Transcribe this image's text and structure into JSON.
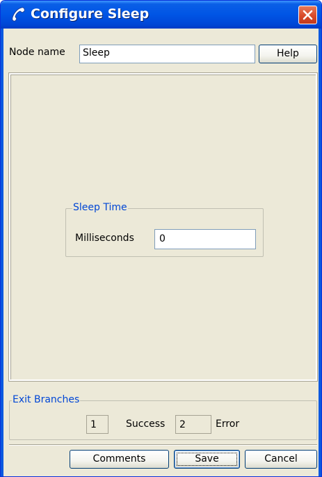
{
  "window": {
    "title": "Configure Sleep",
    "icons": {
      "app": "phone-handset-icon",
      "close": "close-icon"
    }
  },
  "header": {
    "node_name_label": "Node name",
    "node_name_value": "Sleep",
    "help_label": "Help"
  },
  "sleep_time": {
    "group_label": "Sleep Time",
    "milliseconds_label": "Milliseconds",
    "milliseconds_value": "0"
  },
  "exit_branches": {
    "group_label": "Exit Branches",
    "branches": [
      {
        "number": "1",
        "label": "Success"
      },
      {
        "number": "2",
        "label": "Error"
      }
    ]
  },
  "footer": {
    "comments_label": "Comments",
    "save_label": "Save",
    "cancel_label": "Cancel"
  },
  "colors": {
    "titlebar": "#0055e5",
    "window_bg": "#ece9d8",
    "group_label": "#0046d5",
    "close_button": "#d94a2a"
  }
}
